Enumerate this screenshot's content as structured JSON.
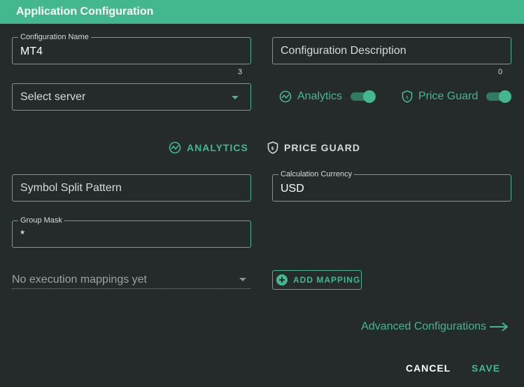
{
  "dialog": {
    "title": "Application Configuration"
  },
  "config_name": {
    "label": "Configuration Name",
    "value": "MT4",
    "counter": "3"
  },
  "config_description": {
    "placeholder": "Configuration Description",
    "counter": "0"
  },
  "server_select": {
    "placeholder": "Select server"
  },
  "toggles": {
    "analytics": {
      "label": "Analytics",
      "on": true
    },
    "price_guard": {
      "label": "Price Guard",
      "on": true
    }
  },
  "tabs": {
    "analytics": "ANALYTICS",
    "price_guard": "PRICE GUARD"
  },
  "symbol_split": {
    "placeholder": "Symbol Split Pattern"
  },
  "calc_currency": {
    "label": "Calculation Currency",
    "value": "USD"
  },
  "group_mask": {
    "label": "Group Mask",
    "value": "*"
  },
  "mappings": {
    "placeholder": "No execution mappings yet",
    "add_label": "ADD MAPPING"
  },
  "advanced": {
    "label": "Advanced Configurations"
  },
  "footer": {
    "cancel": "CANCEL",
    "save": "SAVE"
  },
  "colors": {
    "accent": "#43b88f",
    "background": "#252a2b",
    "toggle_track": "#2f7a60"
  },
  "icons": [
    "analytics-icon",
    "shield-icon",
    "chevron-down-icon",
    "add-circle-icon",
    "arrow-right-icon"
  ]
}
